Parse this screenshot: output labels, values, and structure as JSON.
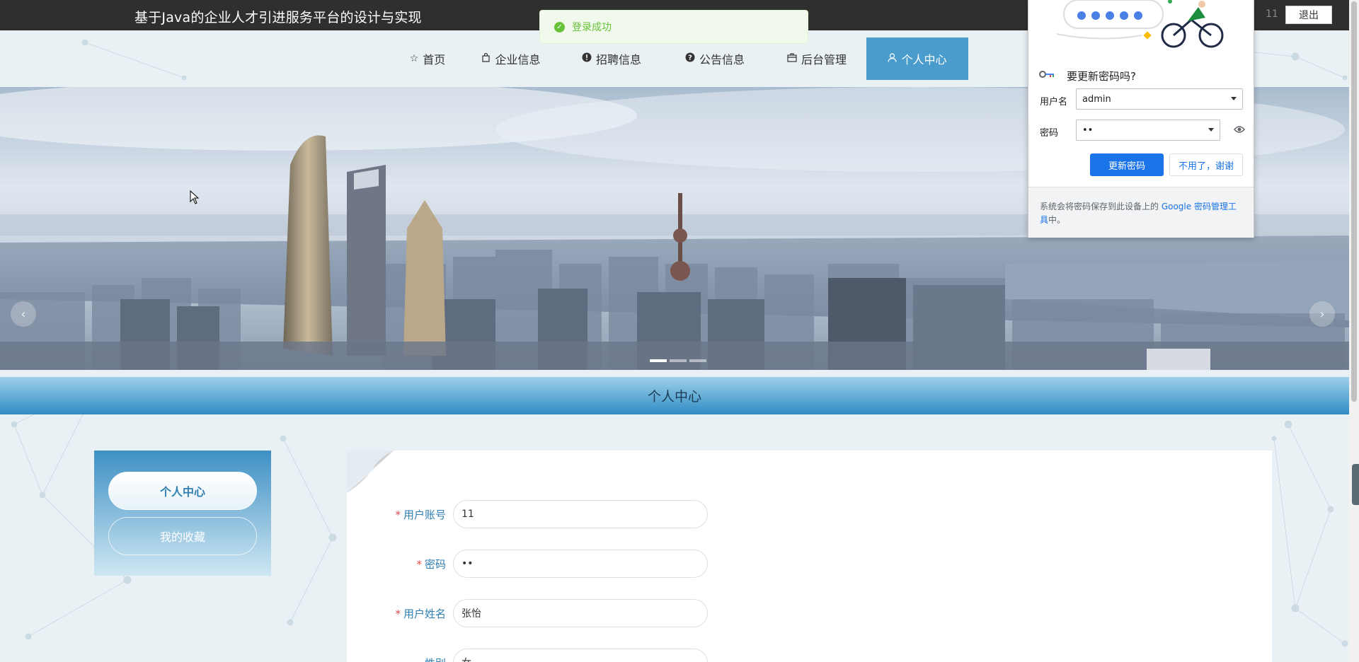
{
  "header": {
    "site_title": "基于Java的企业人才引进服务平台的设计与实现",
    "username": "11",
    "logout_label": "退出"
  },
  "nav": {
    "items": [
      {
        "label": "首页",
        "icon": "star-icon"
      },
      {
        "label": "企业信息",
        "icon": "bag-icon"
      },
      {
        "label": "招聘信息",
        "icon": "alert-circle-icon"
      },
      {
        "label": "公告信息",
        "icon": "question-circle-icon"
      },
      {
        "label": "后台管理",
        "icon": "box-icon"
      },
      {
        "label": "个人中心",
        "icon": "user-icon",
        "active": true
      }
    ]
  },
  "carousel": {
    "prev": "‹",
    "next": "›"
  },
  "section": {
    "title": "个人中心"
  },
  "side_menu": {
    "items": [
      {
        "label": "个人中心",
        "active": true
      },
      {
        "label": "我的收藏",
        "active": false
      }
    ]
  },
  "form": {
    "fields": [
      {
        "label": "用户账号",
        "value": "11",
        "required": true
      },
      {
        "label": "密码",
        "value": "••",
        "required": true
      },
      {
        "label": "用户姓名",
        "value": "张怡",
        "required": true
      },
      {
        "label": "性别",
        "value": "女",
        "required": false
      }
    ]
  },
  "toast": {
    "message": "登录成功"
  },
  "password_prompt": {
    "title": "要更新密码吗?",
    "username_label": "用户名",
    "username_value": "admin",
    "password_label": "密码",
    "password_value": "••",
    "update_label": "更新密码",
    "dismiss_label": "不用了，谢谢",
    "footer_text_before": "系统会将密码保存到此设备上的 ",
    "footer_link": "Google 密码管理工具",
    "footer_text_after": "中。"
  },
  "colors": {
    "accent": "#4a9ccc",
    "topbar": "#2f2f2f",
    "google_blue": "#1a73e8",
    "success": "#67c23a"
  }
}
